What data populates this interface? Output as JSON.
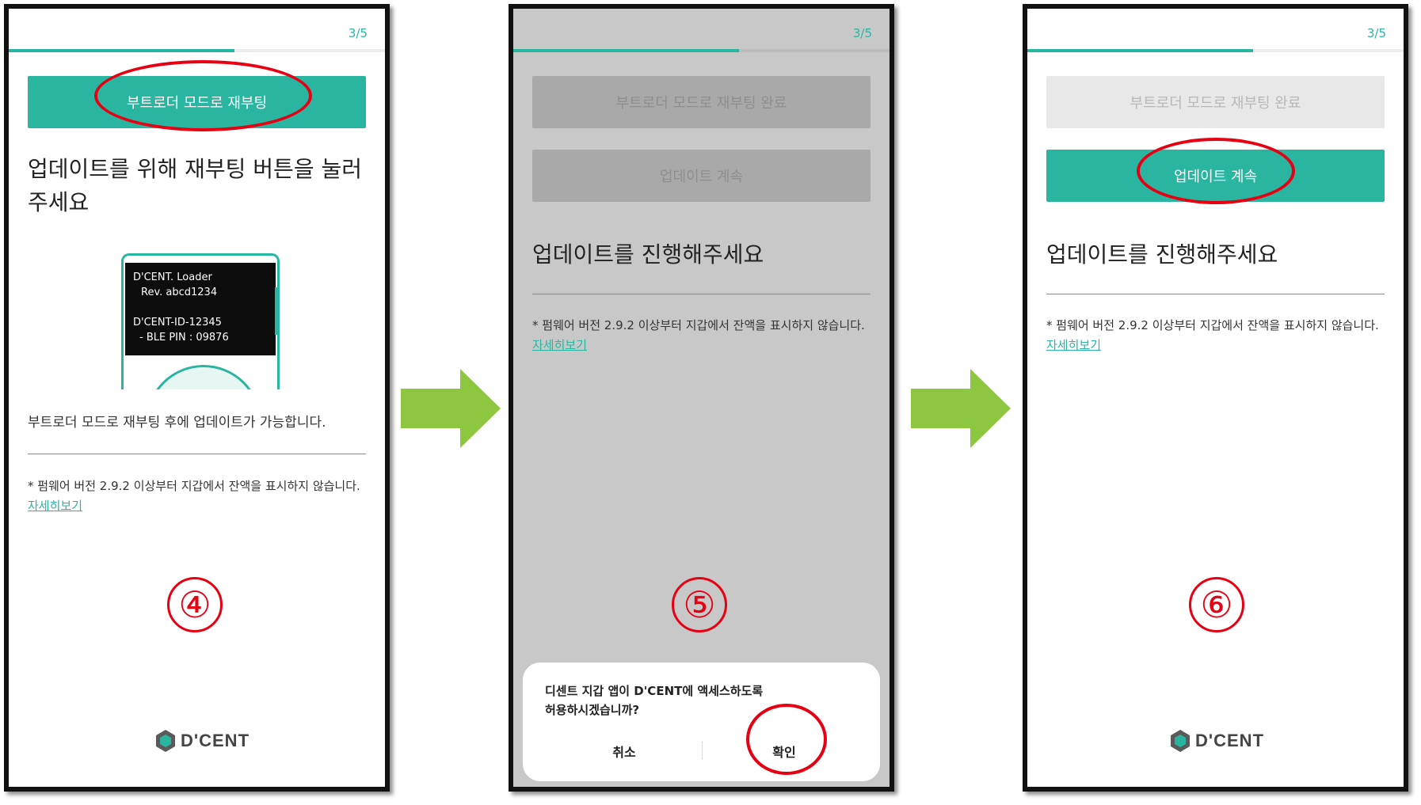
{
  "screen4": {
    "step": "3/5",
    "progress": 0.6,
    "reboot_button": "부트로더 모드로 재부팅",
    "heading_line1": "업데이트를 위해 재부팅 버튼을 눌러",
    "heading_line2": "주세요",
    "device": {
      "line1": "D'CENT. Loader",
      "line2": "Rev. abcd1234",
      "line3": "D'CENT-ID-12345",
      "line4": "- BLE PIN : 09876"
    },
    "sub_text": "부트로더 모드로 재부팅 후에 업데이트가 가능합니다.",
    "note_text": "* 펌웨어 버전 2.9.2 이상부터 지갑에서 잔액을 표시하지 않습니다.",
    "note_link": "자세히보기",
    "badge": "④",
    "logo_text": "D'CENT"
  },
  "screen5": {
    "step": "3/5",
    "progress": 0.6,
    "reboot_done_button": "부트로더 모드로 재부팅 완료",
    "continue_button": "업데이트 계속",
    "heading": "업데이트를 진행해주세요",
    "note_text": "* 펌웨어 버전 2.9.2 이상부터 지갑에서 잔액을 표시하지 않습니다.",
    "note_link": "자세히보기",
    "badge": "⑤",
    "dialog": {
      "message_line1": "디센트 지갑 앱이 D'CENT에 액세스하도록",
      "message_line2": "허용하시겠습니까?",
      "cancel": "취소",
      "confirm": "확인"
    }
  },
  "screen6": {
    "step": "3/5",
    "progress": 0.6,
    "reboot_done_button": "부트로더 모드로 재부팅 완료",
    "continue_button": "업데이트 계속",
    "heading": "업데이트를 진행해주세요",
    "note_text": "* 펌웨어 버전 2.9.2 이상부터 지갑에서 잔액을 표시하지 않습니다.",
    "note_link": "자세히보기",
    "badge": "⑥",
    "logo_text": "D'CENT"
  },
  "colors": {
    "accent": "#2ab5a0",
    "highlight_red": "#e60012",
    "arrow_green": "#8dc63f"
  }
}
